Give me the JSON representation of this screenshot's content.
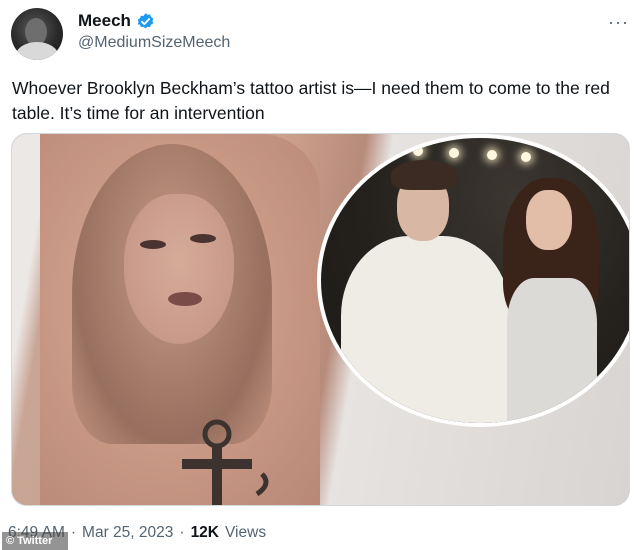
{
  "author": {
    "name": "Meech",
    "handle": "@MediumSizeMeech",
    "verified": true
  },
  "tweet": {
    "text": "Whoever Brooklyn Beckham’s tattoo artist is—I need them to come to the red table. It’s time for an intervention"
  },
  "menu": {
    "more_icon": "more-horizontal-icon",
    "glyph": "···"
  },
  "meta": {
    "time": "6:49 AM",
    "separator": "·",
    "date": "Mar 25, 2023",
    "views_count": "12K",
    "views_label": "Views"
  },
  "credit": {
    "label": "Twitter"
  },
  "colors": {
    "verified_blue": "#1d9bf0",
    "text_primary": "#0f1419",
    "text_secondary": "#536471",
    "border": "#cfd9de"
  }
}
